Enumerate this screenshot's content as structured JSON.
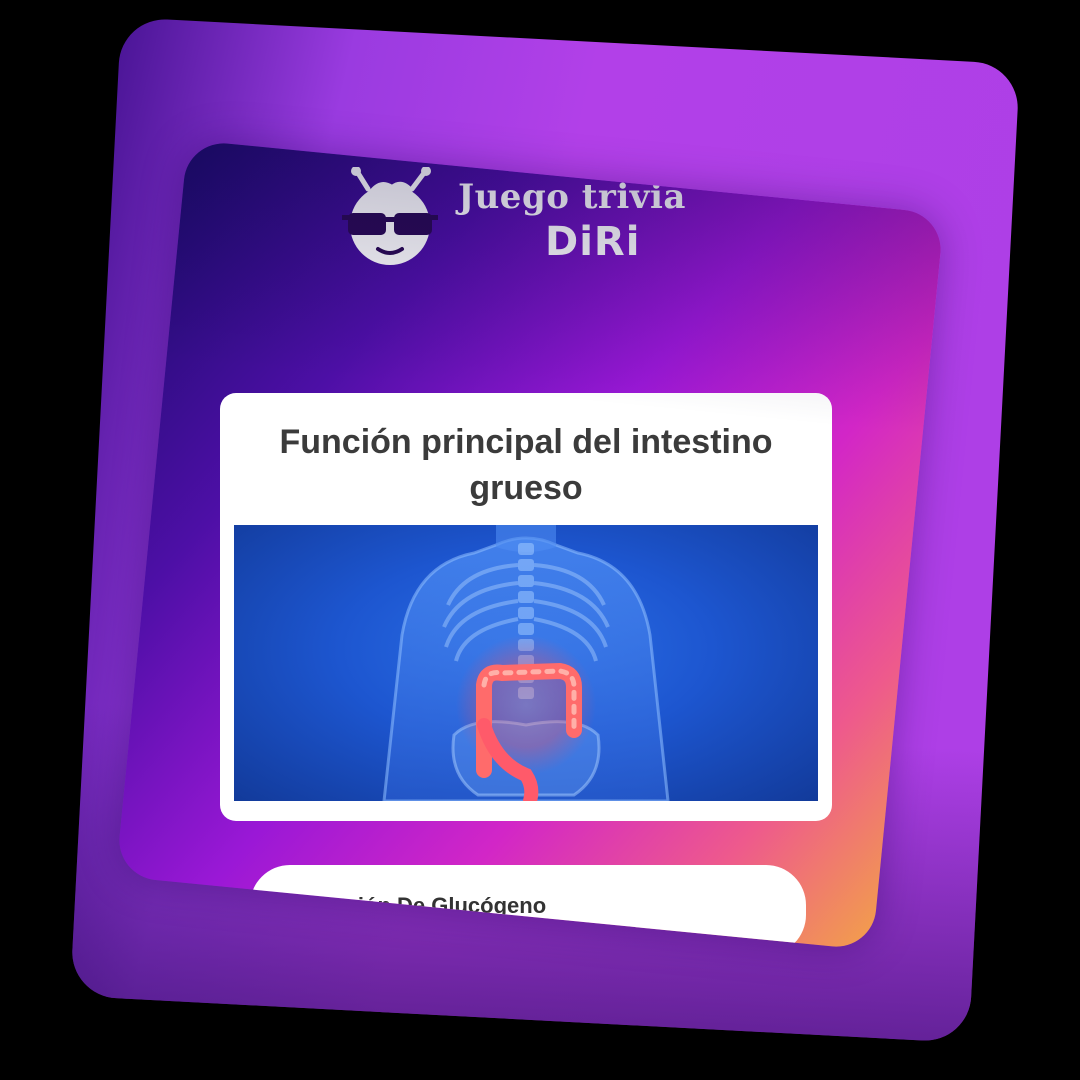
{
  "logo": {
    "title": "Juego trivia",
    "brand": "DiRi",
    "mascot_icon": "sunglasses-mascot-icon"
  },
  "question": {
    "title": "Función principal del intestino grueso",
    "image": "large-intestine-anatomy-illustration"
  },
  "answers": [
    {
      "label": "Lesión De Glucógeno"
    }
  ],
  "colors": {
    "gradient_start": "#1b0b6b",
    "gradient_mid": "#9a18d6",
    "gradient_pink": "#d226c7",
    "gradient_end": "#f2a04a",
    "back_slab": "#b240e8",
    "card_bg": "#ffffff",
    "text_dark": "#3b3b3b"
  }
}
